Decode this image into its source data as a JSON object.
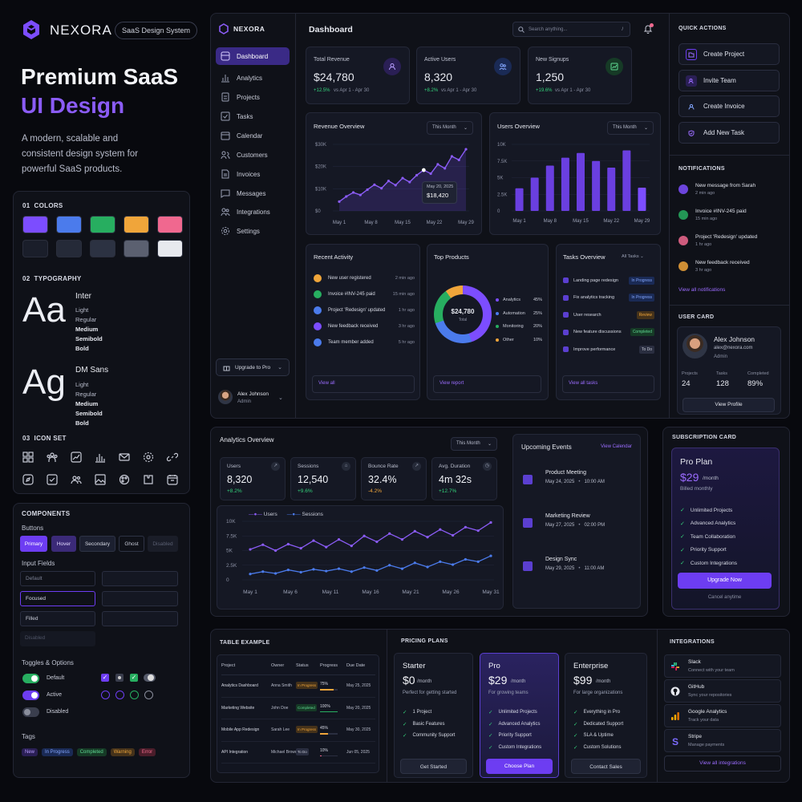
{
  "brand": {
    "name": "NEXORA",
    "badge": "SaaS Design System"
  },
  "hero": {
    "title_line1": "Premium SaaS",
    "title_line2": "UI Design",
    "description_l1": "A modern, scalable and",
    "description_l2": "consistent design system for",
    "description_l3": "powerful SaaS products."
  },
  "colors_section": {
    "label": "01  COLORS",
    "row1": [
      "#7c4dff",
      "#4b7bec",
      "#27ae60",
      "#f0a53a",
      "#f0688f"
    ],
    "row2": [
      "#1a1e2a",
      "#252a38",
      "#2c3242",
      "#5b6070",
      "#e7e9ee"
    ]
  },
  "typography": {
    "label": "02  TYPOGRAPHY",
    "sample1": "Aa",
    "font1": "Inter",
    "weights1": [
      "Light",
      "Regular",
      "Medium",
      "Semibold",
      "Bold"
    ],
    "sample2": "Ag",
    "font2": "DM Sans",
    "weights2": [
      "Light",
      "Regular",
      "Medium",
      "Semibold",
      "Bold"
    ]
  },
  "iconset": {
    "label": "03  ICON SET"
  },
  "components": {
    "title": "COMPONENTS",
    "buttons_label": "Buttons",
    "buttons": [
      "Primary",
      "Hover",
      "Secondary",
      "Ghost",
      "Disabled"
    ],
    "inputs_label": "Input Fields",
    "inputs": [
      "Default",
      "Focused",
      "Filled",
      "Disabled"
    ],
    "toggles_label": "Toggles & Options",
    "toggles": [
      "Default",
      "Active",
      "Disabled"
    ],
    "tags_label": "Tags",
    "tags": [
      "New",
      "In Progress",
      "Completed",
      "Warning",
      "Error"
    ]
  },
  "sidebar": {
    "brand": "NEXORA",
    "items": [
      "Dashboard",
      "Analytics",
      "Projects",
      "Tasks",
      "Calendar",
      "Customers",
      "Invoices",
      "Messages",
      "Integrations",
      "Settings"
    ],
    "upgrade": "Upgrade to Pro",
    "user_name": "Alex Johnson",
    "user_role": "Admin"
  },
  "dashboard": {
    "title": "Dashboard",
    "search_placeholder": "Search anything...",
    "search_key": "/",
    "stats": [
      {
        "label": "Total Revenue",
        "value": "$24,780",
        "delta": "+12.5%",
        "range": "vs Apr 1 - Apr 30"
      },
      {
        "label": "Active Users",
        "value": "8,320",
        "delta": "+8.2%",
        "range": "vs Apr 1 - Apr 30"
      },
      {
        "label": "New Signups",
        "value": "1,250",
        "delta": "+19.6%",
        "range": "vs Apr 1 - Apr 30"
      }
    ],
    "revenue": {
      "title": "Revenue Overview",
      "range": "This Month",
      "tooltip_date": "May 20, 2025",
      "tooltip_value": "$18,420"
    },
    "users": {
      "title": "Users Overview",
      "range": "This Month"
    },
    "activity": {
      "title": "Recent Activity",
      "items": [
        {
          "text": "New user registered",
          "time": "2 min ago",
          "color": "#f0a53a"
        },
        {
          "text": "Invoice #INV-245 paid",
          "time": "15 min ago",
          "color": "#27ae60"
        },
        {
          "text": "Project 'Redesign' updated",
          "time": "1 hr ago",
          "color": "#4b7bec"
        },
        {
          "text": "New feedback received",
          "time": "3 hr ago",
          "color": "#7c4dff"
        },
        {
          "text": "Team member added",
          "time": "5 hr ago",
          "color": "#4b7bec"
        }
      ],
      "link": "View all"
    },
    "products": {
      "title": "Top Products",
      "total": "$24,780",
      "total_label": "Total",
      "items": [
        {
          "name": "Analytics",
          "pct": "45%",
          "color": "#7c4dff"
        },
        {
          "name": "Automation",
          "pct": "25%",
          "color": "#4b7bec"
        },
        {
          "name": "Monitoring",
          "pct": "20%",
          "color": "#27ae60"
        },
        {
          "name": "Other",
          "pct": "10%",
          "color": "#f0a53a"
        }
      ],
      "link": "View report"
    },
    "tasks": {
      "title": "Tasks Overview",
      "filter": "All Tasks",
      "items": [
        {
          "name": "Landing page redesign",
          "status": "In Progress"
        },
        {
          "name": "Fix analytics tracking",
          "status": "In Progress"
        },
        {
          "name": "User research",
          "status": "Review"
        },
        {
          "name": "New feature discussions",
          "status": "Completed"
        },
        {
          "name": "Improve performance",
          "status": "To Do"
        }
      ],
      "link": "View all tasks"
    }
  },
  "quick_actions": {
    "title": "QUICK ACTIONS",
    "items": [
      "Create Project",
      "Invite Team",
      "Create Invoice",
      "Add New Task"
    ]
  },
  "notifications": {
    "title": "NOTIFICATIONS",
    "items": [
      {
        "text": "New message from Sarah",
        "time": "2 min ago",
        "color": "#7c4dff"
      },
      {
        "text": "Invoice #INV-245 paid",
        "time": "15 min ago",
        "color": "#27ae60"
      },
      {
        "text": "Project 'Redesign' updated",
        "time": "1 hr ago",
        "color": "#f0688f"
      },
      {
        "text": "New feedback received",
        "time": "3 hr ago",
        "color": "#f0a53a"
      }
    ],
    "link": "View all notifications"
  },
  "user_card": {
    "title": "USER CARD",
    "name": "Alex Johnson",
    "email": "alex@nexora.com",
    "role": "Admin",
    "stats": [
      {
        "label": "Projects",
        "value": "24"
      },
      {
        "label": "Tasks",
        "value": "128"
      },
      {
        "label": "Completed",
        "value": "89%"
      }
    ],
    "button": "View Profile"
  },
  "analytics": {
    "title": "Analytics Overview",
    "range": "This Month",
    "stats": [
      {
        "label": "Users",
        "value": "8,320",
        "delta": "+8.2%"
      },
      {
        "label": "Sessions",
        "value": "12,540",
        "delta": "+9.6%"
      },
      {
        "label": "Bounce Rate",
        "value": "32.4%",
        "delta": "-4.2%"
      },
      {
        "label": "Avg. Duration",
        "value": "4m 32s",
        "delta": "+12.7%"
      }
    ]
  },
  "events": {
    "title": "Upcoming Events",
    "link": "View Calendar",
    "items": [
      {
        "name": "Product Meeting",
        "date": "May 24, 2025",
        "time": "10:00 AM"
      },
      {
        "name": "Marketing Review",
        "date": "May 27, 2025",
        "time": "02:00 PM"
      },
      {
        "name": "Design Sync",
        "date": "May 29, 2025",
        "time": "11:00 AM"
      }
    ]
  },
  "subscription": {
    "title": "SUBSCRIPTION CARD",
    "plan": "Pro Plan",
    "price": "$29",
    "period": "/month",
    "billing": "Billed monthly",
    "features": [
      "Unlimited Projects",
      "Advanced Analytics",
      "Team Collaboration",
      "Priority Support",
      "Custom Integrations"
    ],
    "button": "Upgrade Now",
    "cancel": "Cancel anytime"
  },
  "table": {
    "title": "TABLE EXAMPLE",
    "headers": [
      "Project",
      "Owner",
      "Status",
      "Progress",
      "Due Date"
    ],
    "rows": [
      {
        "project": "Analytics Dashboard",
        "owner": "Anna Smith",
        "status": "In Progress",
        "progress": "75%",
        "due": "May 25, 2025"
      },
      {
        "project": "Marketing Website",
        "owner": "John Doe",
        "status": "Completed",
        "progress": "100%",
        "due": "May 20, 2025"
      },
      {
        "project": "Mobile App Redesign",
        "owner": "Sarah Lee",
        "status": "In Progress",
        "progress": "45%",
        "due": "May 30, 2025"
      },
      {
        "project": "API Integration",
        "owner": "Michael Brown",
        "status": "To Do",
        "progress": "10%",
        "due": "Jun 05, 2025"
      }
    ]
  },
  "pricing": {
    "title": "PRICING PLANS",
    "plans": [
      {
        "name": "Starter",
        "price": "$0",
        "period": "/month",
        "desc": "Perfect for getting started",
        "features": [
          "1 Project",
          "Basic Features",
          "Community Support"
        ],
        "button": "Get Started"
      },
      {
        "name": "Pro",
        "price": "$29",
        "period": "/month",
        "desc": "For growing teams",
        "features": [
          "Unlimited Projects",
          "Advanced Analytics",
          "Priority Support",
          "Custom Integrations"
        ],
        "button": "Choose Plan"
      },
      {
        "name": "Enterprise",
        "price": "$99",
        "period": "/month",
        "desc": "For large organizations",
        "features": [
          "Everything in Pro",
          "Dedicated Support",
          "SLA & Uptime",
          "Custom Solutions"
        ],
        "button": "Contact Sales"
      }
    ]
  },
  "integrations": {
    "title": "INTEGRATIONS",
    "items": [
      {
        "name": "Slack",
        "desc": "Connect with your team"
      },
      {
        "name": "GitHub",
        "desc": "Sync your repositories"
      },
      {
        "name": "Google Analytics",
        "desc": "Track your data"
      },
      {
        "name": "Stripe",
        "desc": "Manage payments"
      }
    ],
    "link": "View all integrations"
  },
  "chart_data": [
    {
      "type": "line",
      "title": "Revenue Overview",
      "x": [
        "May 1",
        "May 8",
        "May 15",
        "May 22",
        "May 29"
      ],
      "yticks": [
        "$30K",
        "$20K",
        "$10K",
        "$0"
      ],
      "ylim": [
        0,
        30000
      ],
      "series": [
        {
          "values": [
            4200,
            6500,
            8300,
            7200,
            9600,
            11800,
            10200,
            13500,
            11600,
            14800,
            13000,
            16100,
            18420,
            16800,
            21000,
            19200,
            24600,
            23000,
            27800
          ]
        }
      ]
    },
    {
      "type": "bar",
      "title": "Users Overview",
      "categories": [
        "May 1",
        "",
        "May 8",
        "",
        "May 15",
        "",
        "May 22",
        "",
        "May 29"
      ],
      "yticks": [
        "10K",
        "7.5K",
        "5K",
        "2.5K",
        "0"
      ],
      "ylim": [
        0,
        10000
      ],
      "values": [
        3400,
        5000,
        6800,
        8000,
        8700,
        7500,
        6500,
        9100,
        3500
      ]
    },
    {
      "type": "line",
      "title": "Analytics Overview",
      "x": [
        "May 1",
        "May 6",
        "May 11",
        "May 16",
        "May 21",
        "May 26",
        "May 31"
      ],
      "yticks": [
        "10K",
        "7.5K",
        "5K",
        "2.5K",
        "0"
      ],
      "ylim": [
        0,
        10000
      ],
      "series": [
        {
          "name": "Users",
          "color": "#8b5cf6",
          "values": [
            5200,
            6000,
            5000,
            6100,
            5400,
            6700,
            5600,
            6900,
            5800,
            7500,
            6500,
            7900,
            6900,
            8300,
            7300,
            8600,
            7600,
            9000,
            8400,
            9800
          ]
        },
        {
          "name": "Sessions",
          "color": "#4b7bec",
          "values": [
            1000,
            1400,
            1100,
            1700,
            1300,
            1800,
            1500,
            1900,
            1400,
            2100,
            1600,
            2500,
            1900,
            2900,
            2200,
            3100,
            2600,
            3500,
            3100,
            4100
          ]
        }
      ]
    }
  ]
}
